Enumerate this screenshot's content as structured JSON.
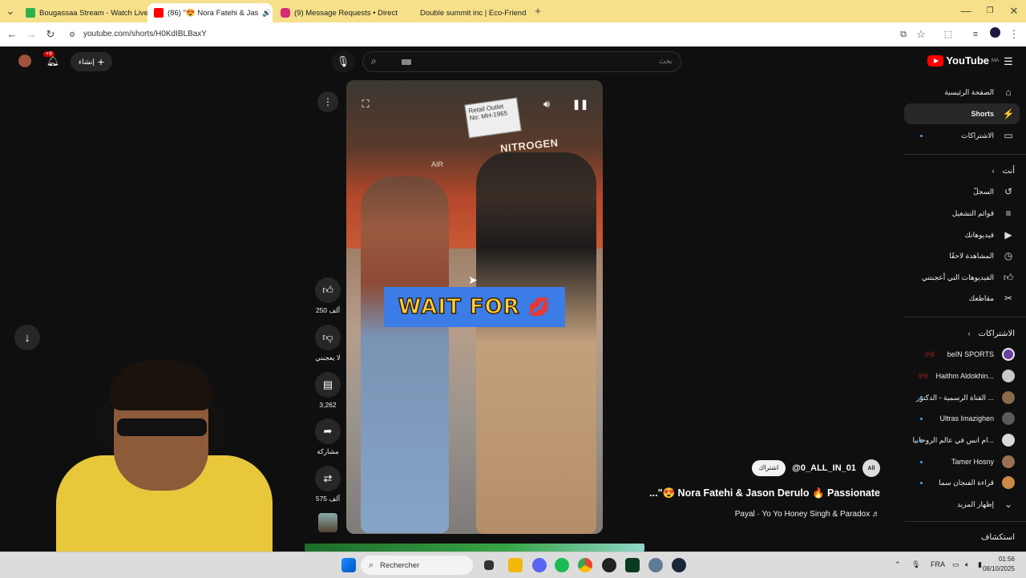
{
  "browser": {
    "tabs": [
      {
        "label": "Bougassaa Stream - Watch Live",
        "favicon_color": "#2bb24c",
        "active": false
      },
      {
        "label": "(86) \"😍 Nora Fatehi & Jas",
        "favicon_color": "#ff0000",
        "active": true
      },
      {
        "label": "(9) Message Requests • Direct",
        "favicon_color": "#d62976",
        "active": false
      },
      {
        "label": "Double summit inc | Eco-Friend",
        "favicon_color": "#f6e089",
        "active": false
      }
    ],
    "url": "youtube.com/shorts/H0KdIBLBaxY"
  },
  "youtube": {
    "logo_text": "YouTube",
    "logo_region": "MA",
    "search_placeholder": "بحث",
    "create_label": "إنشاء",
    "notification_count": "+9",
    "sidebar": {
      "main": [
        {
          "label": "الصفحة الرئيسية",
          "icon": "home-icon"
        },
        {
          "label": "Shorts",
          "icon": "shorts-icon",
          "selected": true
        },
        {
          "label": "الاشتراكات",
          "icon": "subscriptions-icon"
        }
      ],
      "you_header": "أنت",
      "you": [
        {
          "label": "السجلّ",
          "icon": "history-icon"
        },
        {
          "label": "قوائم التشغيل",
          "icon": "playlists-icon"
        },
        {
          "label": "فيديوهاتك",
          "icon": "your-videos-icon"
        },
        {
          "label": "المشاهدة لاحقًا",
          "icon": "watch-later-icon"
        },
        {
          "label": "الفيديوهات التي أعجبتني",
          "icon": "liked-icon"
        },
        {
          "label": "مقاطعك",
          "icon": "clips-icon"
        }
      ],
      "subs_header": "الاشتراكات",
      "subscriptions": [
        {
          "label": "beIN SPORTS",
          "avatar_color": "#6b3fa0",
          "live": true
        },
        {
          "label": "Haithm Aldokhin...",
          "avatar_color": "#c9c9c9",
          "live": true
        },
        {
          "label": "القناة الرسمية - الدكتور ...",
          "avatar_color": "#8a6a4a",
          "live": false
        },
        {
          "label": "Ultras Imazighen",
          "avatar_color": "#5a5a5a",
          "live": false
        },
        {
          "label": "ام انس في عالم الروحانيا...",
          "avatar_color": "#d9d9d9",
          "live": false
        },
        {
          "label": "Tamer Hosny",
          "avatar_color": "#9a7050",
          "live": false
        },
        {
          "label": "قراءة الفنجان سما",
          "avatar_color": "#c98a4a",
          "live": false
        }
      ],
      "show_more": "إظهار المزيد",
      "explore_header": "استكشاف"
    },
    "short": {
      "overlay_text": "WAIT FOR",
      "sign_text": "Retail Outlet No: MH-1965",
      "storefront_text": "NITROGEN",
      "air_text": "AIR",
      "likes": "250 ألف",
      "dislike_label": "لا يعجبني",
      "comments": "3,262",
      "share_label": "مشاركة",
      "remix_count": "575 ألف",
      "channel_handle": "@0_ALL_IN_01",
      "channel_avatar_text": "All",
      "subscribe_label": "اشتراك",
      "title": "...\"😍 Nora Fatehi & Jason Derulo 🔥 Passionate",
      "music": "Payal · Yo Yo Honey Singh & Paradox ♬"
    }
  },
  "taskbar": {
    "search_placeholder": "Rechercher",
    "language": "FRA",
    "time": "01:56",
    "date": "08/10/2025"
  }
}
